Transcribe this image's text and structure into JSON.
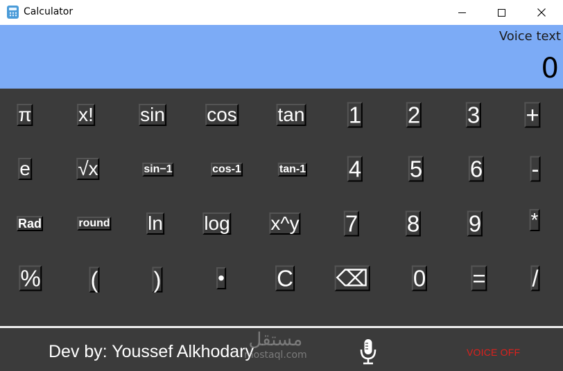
{
  "window": {
    "title": "Calculator",
    "controls": {
      "minimize": "minimize",
      "maximize": "maximize",
      "close": "close"
    }
  },
  "display": {
    "voice_label": "Voice text",
    "value": "0"
  },
  "keys": [
    [
      "π",
      "x!",
      "sin",
      "cos",
      "tan",
      "1",
      "2",
      "3",
      "+"
    ],
    [
      "e",
      "√x",
      "sin−1",
      "cos-1",
      "tan-1",
      "4",
      "5",
      "6",
      "-"
    ],
    [
      "Rad",
      "round",
      "ln",
      "log",
      "x^y",
      "7",
      "8",
      "9",
      "*"
    ],
    [
      "%",
      "(",
      ")",
      "•",
      "C",
      "⌫",
      "0",
      "=",
      "/"
    ]
  ],
  "footer": {
    "dev_by": "Dev by: Youssef Alkhodary",
    "watermark_arabic": "مستقل",
    "watermark_url": "mostaql.com",
    "voice_status": "VOICE OFF"
  },
  "colors": {
    "display_bg": "#7cabf6",
    "keypad_bg": "#3b3b3b",
    "voice_off": "#e0201c"
  },
  "icons": {
    "app": "calculator-icon",
    "mic": "microphone-icon",
    "backspace": "backspace-icon"
  }
}
